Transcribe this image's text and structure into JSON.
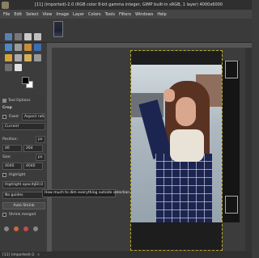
{
  "window": {
    "title": "[11] (imported)-2.0 (RGB color 8-bit gamma integer, GIMP built-in sRGB, 1 layer) 4000x6000"
  },
  "menubar": {
    "items": [
      "File",
      "Edit",
      "Select",
      "View",
      "Image",
      "Layer",
      "Colors",
      "Tools",
      "Filters",
      "Windows",
      "Help"
    ]
  },
  "tool_options": {
    "tab_label": "Tool Options",
    "tool_name": "Crop",
    "fixed_label": "Fixed",
    "fixed_value": "Aspect ratio",
    "ratio_value": "Current",
    "position_label": "Position:",
    "position_unit": "px",
    "position_x": "46",
    "position_y": "264",
    "size_label": "Size:",
    "size_unit": "px",
    "size_w": "4040",
    "size_h": "4040",
    "highlight_label": "Highlight",
    "highlight_opacity_label": "Highlight opacity",
    "highlight_opacity_value": "50.0",
    "guides_value": "No guides",
    "auto_shrink_label": "Auto Shrink",
    "shrink_merged_label": "Shrink merged"
  },
  "tooltip": {
    "text": "How much to dim everything outside selection"
  },
  "statusbar": {
    "tab_label": "[11] (imported)-2.",
    "close_label": "×"
  },
  "colors": {
    "accent": "#b8a836",
    "panel": "#3b3b3b"
  }
}
